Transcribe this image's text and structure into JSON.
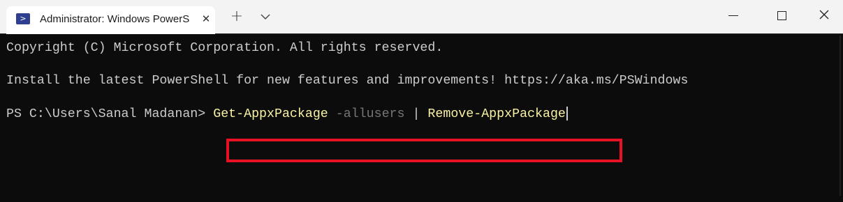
{
  "tab": {
    "title": "Administrator: Windows PowerS",
    "icon": "powershell-icon"
  },
  "titlebar": {
    "new_tab_glyph": "+",
    "dropdown_icon": "chevron-down-icon"
  },
  "window_controls": {
    "minimize": "minimize-icon",
    "maximize": "maximize-icon",
    "close": "close-icon"
  },
  "terminal": {
    "line1": "Copyright (C) Microsoft Corporation. All rights reserved.",
    "line2": "Install the latest PowerShell for new features and improvements! https://aka.ms/PSWindows",
    "prompt": "PS C:\\Users\\Sanal Madanan> ",
    "command": {
      "cmdlet1": "Get-AppxPackage",
      "parameter": " -allusers",
      "pipe": " | ",
      "cmdlet2": "Remove-AppxPackage"
    }
  },
  "colors": {
    "background": "#0c0c0c",
    "text": "#cccccc",
    "cmdlet": "#f9f1a5",
    "parameter": "#767676",
    "highlight_border": "#e81123",
    "titlebar": "#f3f3f3"
  }
}
